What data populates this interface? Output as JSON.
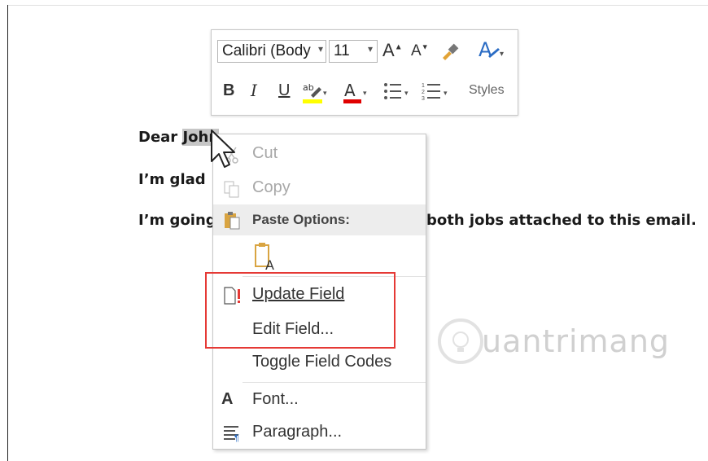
{
  "mini_toolbar": {
    "font_name": "Calibri (Body",
    "font_size": "11",
    "styles_label": "Styles",
    "icons": {
      "grow_font": "grow-font-icon",
      "shrink_font": "shrink-font-icon",
      "format_painter": "format-painter-icon",
      "styles": "styles-icon",
      "bold": "B",
      "italic": "I",
      "underline": "U",
      "highlight": "highlight-icon",
      "font_color": "font-color-icon",
      "bullets": "bullets-icon",
      "numbering": "numbering-icon"
    },
    "colors": {
      "highlight": "#ffff00",
      "font_color": "#e00000",
      "accent": "#2b6cc4"
    }
  },
  "document": {
    "line1_prefix": "Dear ",
    "line1_selected": "John",
    "line2": "I’m glad",
    "line3_left": "I’m going",
    "line3_right": "both jobs attached to this email."
  },
  "context_menu": {
    "cut": "Cut",
    "copy": "Copy",
    "paste_options": "Paste Options:",
    "update_field": "Update Field",
    "edit_field": "Edit Field...",
    "toggle_field_codes": "Toggle Field Codes",
    "font": "Font...",
    "paragraph": "Paragraph..."
  },
  "watermark": {
    "text": "uantrimang"
  },
  "colors": {
    "highlight_box": "#e53935",
    "selection": "#c6c6c6"
  }
}
